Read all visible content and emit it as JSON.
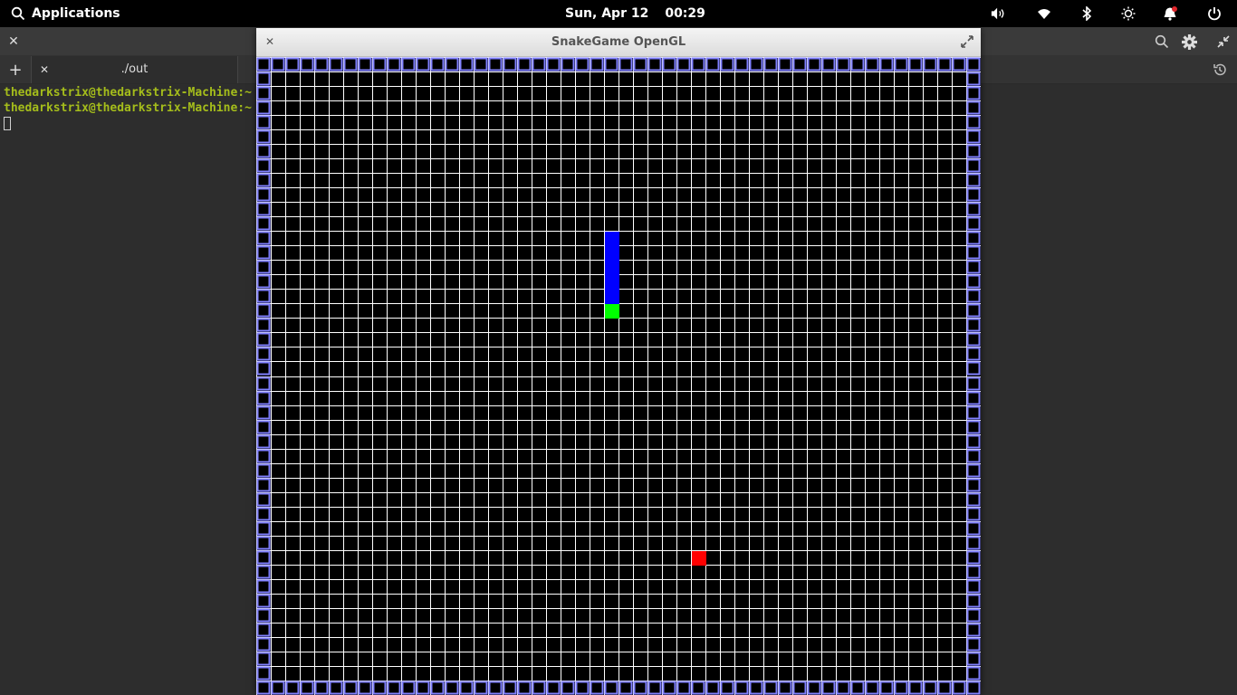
{
  "panel": {
    "applications_label": "Applications",
    "date": "Sun, Apr 12",
    "time": "00:29",
    "icons": [
      "search-icon",
      "volume-icon",
      "wifi-icon",
      "bluetooth-icon",
      "brightness-icon",
      "notification-bell-icon",
      "power-icon"
    ]
  },
  "terminal": {
    "tab_label": "./out",
    "lines": [
      "thedarkstrix@thedarkstrix-Machine:~",
      "thedarkstrix@thedarkstrix-Machine:~"
    ],
    "prompt_color": "#a5bd1b"
  },
  "game": {
    "title": "SnakeGame OpenGL",
    "grid": {
      "cols": 50,
      "rows": 44,
      "line_color": "#ffffff",
      "border_color": "#8080ff"
    },
    "snake": {
      "body_color": "#0000ff",
      "head_color": "#00ff00",
      "body_cells": [
        [
          24,
          12
        ],
        [
          24,
          13
        ],
        [
          24,
          14
        ],
        [
          24,
          15
        ],
        [
          24,
          16
        ]
      ],
      "head_cell": [
        24,
        17
      ]
    },
    "food": {
      "color": "#ff0000",
      "cell": [
        30,
        34
      ]
    }
  }
}
